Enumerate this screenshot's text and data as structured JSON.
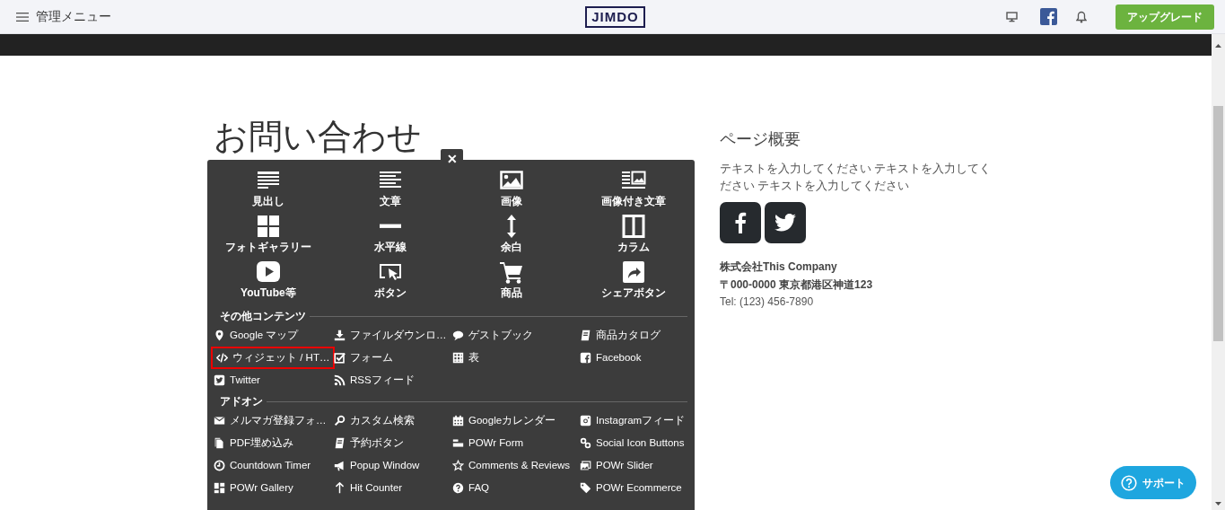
{
  "topbar": {
    "menu_label": "管理メニュー",
    "logo": "JIMDO",
    "upgrade_button": "アップグレード"
  },
  "page": {
    "title": "お問い合わせ"
  },
  "add_panel": {
    "close": "✕",
    "main_items": [
      {
        "label": "見出し"
      },
      {
        "label": "文章"
      },
      {
        "label": "画像"
      },
      {
        "label": "画像付き文章"
      },
      {
        "label": "フォトギャラリー"
      },
      {
        "label": "水平線"
      },
      {
        "label": "余白"
      },
      {
        "label": "カラム"
      },
      {
        "label": "YouTube等"
      },
      {
        "label": "ボタン"
      },
      {
        "label": "商品"
      },
      {
        "label": "シェアボタン"
      }
    ],
    "sections": [
      {
        "title": "その他コンテンツ",
        "items": [
          {
            "label": "Google マップ",
            "highlighted": false
          },
          {
            "label": "ファイルダウンロ…",
            "highlighted": false
          },
          {
            "label": "ゲストブック",
            "highlighted": false
          },
          {
            "label": "商品カタログ",
            "highlighted": false
          },
          {
            "label": "ウィジェット / HT…",
            "highlighted": true
          },
          {
            "label": "フォーム",
            "highlighted": false
          },
          {
            "label": "表",
            "highlighted": false
          },
          {
            "label": "Facebook",
            "highlighted": false
          },
          {
            "label": "Twitter",
            "highlighted": false
          },
          {
            "label": "RSSフィード",
            "highlighted": false
          }
        ]
      },
      {
        "title": "アドオン",
        "items": [
          {
            "label": "メルマガ登録フォ…",
            "highlighted": false
          },
          {
            "label": "カスタム検索",
            "highlighted": false
          },
          {
            "label": "Googleカレンダー",
            "highlighted": false
          },
          {
            "label": "Instagramフィード",
            "highlighted": false
          },
          {
            "label": "PDF埋め込み",
            "highlighted": false
          },
          {
            "label": "予約ボタン",
            "highlighted": false
          },
          {
            "label": "POWr Form",
            "highlighted": false
          },
          {
            "label": "Social Icon Buttons",
            "highlighted": false
          },
          {
            "label": "Countdown Timer",
            "highlighted": false
          },
          {
            "label": "Popup Window",
            "highlighted": false
          },
          {
            "label": "Comments & Reviews",
            "highlighted": false
          },
          {
            "label": "POWr Slider",
            "highlighted": false
          },
          {
            "label": "POWr Gallery",
            "highlighted": false
          },
          {
            "label": "Hit Counter",
            "highlighted": false
          },
          {
            "label": "FAQ",
            "highlighted": false
          },
          {
            "label": "POWr Ecommerce",
            "highlighted": false
          }
        ]
      }
    ]
  },
  "sidebar": {
    "title": "ページ概要",
    "text": "テキストを入力してください テキストを入力してください テキストを入力してください",
    "company": "株式会社This Company",
    "address": "〒000-0000 東京都港区神道123",
    "tel": "Tel: (123) 456-7890"
  },
  "support_button": "サポート"
}
